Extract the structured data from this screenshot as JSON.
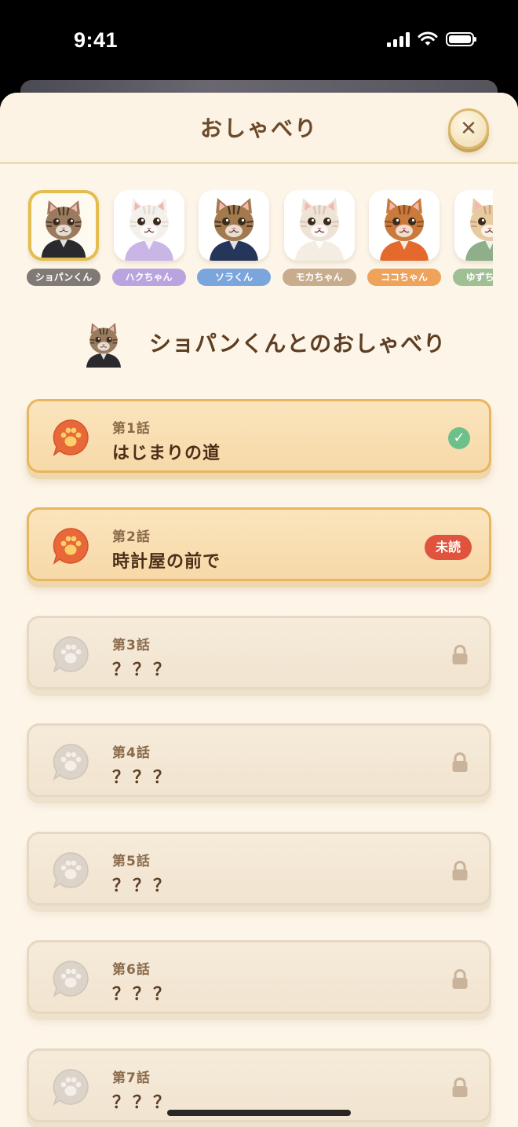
{
  "status_bar": {
    "time": "9:41"
  },
  "header": {
    "title": "おしゃべり"
  },
  "characters": [
    {
      "label": "ショパンくん",
      "color": "#7f7a76",
      "fur": "#9a7b5d",
      "stripe": "#4a3a2e",
      "shirt": "#2a2a2e",
      "selected": true
    },
    {
      "label": "ハクちゃん",
      "color": "#b9a4df",
      "fur": "#f4f0ec",
      "stripe": "#e3dad2",
      "shirt": "#c9b5e6",
      "selected": false
    },
    {
      "label": "ソラくん",
      "color": "#7aa5dd",
      "fur": "#a27a4e",
      "stripe": "#4b3624",
      "shirt": "#26355a",
      "selected": false
    },
    {
      "label": "モカちゃん",
      "color": "#c8ac8e",
      "fur": "#eee3d6",
      "stripe": "#d9c7b2",
      "shirt": "#f3ede2",
      "selected": false
    },
    {
      "label": "ココちゃん",
      "color": "#eea25a",
      "fur": "#c97a3c",
      "stripe": "#8d4f22",
      "shirt": "#e36a2c",
      "selected": false
    },
    {
      "label": "ゆずちゃん",
      "color": "#9fbf95",
      "fur": "#e9cba3",
      "stripe": "#caa277",
      "shirt": "#8fae8a",
      "selected": false
    }
  ],
  "selected_character": {
    "title": "ショパンくんとのおしゃべり"
  },
  "episodes": [
    {
      "number": "第1話",
      "title": "はじまりの道",
      "state": "done",
      "check": "✓"
    },
    {
      "number": "第2話",
      "title": "時計屋の前で",
      "state": "unread",
      "badge": "未読"
    },
    {
      "number": "第3話",
      "title": "？？？",
      "state": "locked"
    },
    {
      "number": "第4話",
      "title": "？？？",
      "state": "locked"
    },
    {
      "number": "第5話",
      "title": "？？？",
      "state": "locked"
    },
    {
      "number": "第6話",
      "title": "？？？",
      "state": "locked"
    },
    {
      "number": "第7話",
      "title": "？？？",
      "state": "locked"
    }
  ],
  "icons": {
    "close": "close-icon",
    "episode_unlocked": "paw-speech-bubble-icon",
    "episode_locked": "paw-speech-bubble-icon",
    "done": "check-icon",
    "locked": "lock-icon"
  },
  "colors": {
    "accent_orange": "#e8683a",
    "unread_red": "#e0533c",
    "done_green": "#6cc08a",
    "sheet_bg": "#fdf5e8"
  }
}
